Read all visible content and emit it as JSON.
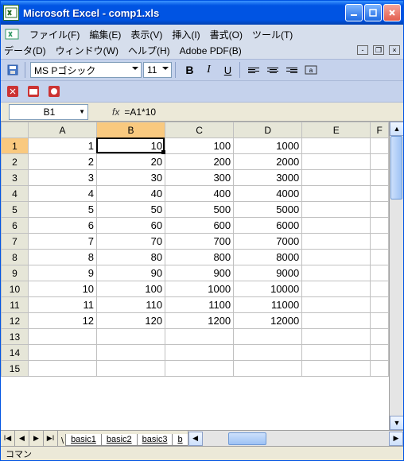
{
  "title": "Microsoft Excel - comp1.xls",
  "menus": {
    "file": "ファイル(F)",
    "edit": "編集(E)",
    "view": "表示(V)",
    "insert": "挿入(I)",
    "format": "書式(O)",
    "tools": "ツール(T)",
    "data": "データ(D)",
    "window": "ウィンドウ(W)",
    "help": "ヘルプ(H)",
    "adobe": "Adobe PDF(B)"
  },
  "font": {
    "name": "MS Pゴシック",
    "size": "11"
  },
  "namebox": "B1",
  "fx_label": "fx",
  "formula": "=A1*10",
  "columns": [
    "A",
    "B",
    "C",
    "D",
    "E",
    "F"
  ],
  "rows": [
    "1",
    "2",
    "3",
    "4",
    "5",
    "6",
    "7",
    "8",
    "9",
    "10",
    "11",
    "12",
    "13",
    "14",
    "15"
  ],
  "data": [
    [
      "1",
      "10",
      "100",
      "1000",
      "",
      ""
    ],
    [
      "2",
      "20",
      "200",
      "2000",
      "",
      ""
    ],
    [
      "3",
      "30",
      "300",
      "3000",
      "",
      ""
    ],
    [
      "4",
      "40",
      "400",
      "4000",
      "",
      ""
    ],
    [
      "5",
      "50",
      "500",
      "5000",
      "",
      ""
    ],
    [
      "6",
      "60",
      "600",
      "6000",
      "",
      ""
    ],
    [
      "7",
      "70",
      "700",
      "7000",
      "",
      ""
    ],
    [
      "8",
      "80",
      "800",
      "8000",
      "",
      ""
    ],
    [
      "9",
      "90",
      "900",
      "9000",
      "",
      ""
    ],
    [
      "10",
      "100",
      "1000",
      "10000",
      "",
      ""
    ],
    [
      "11",
      "110",
      "1100",
      "11000",
      "",
      ""
    ],
    [
      "12",
      "120",
      "1200",
      "12000",
      "",
      ""
    ],
    [
      "",
      "",
      "",
      "",
      "",
      ""
    ],
    [
      "",
      "",
      "",
      "",
      "",
      ""
    ],
    [
      "",
      "",
      "",
      "",
      "",
      ""
    ]
  ],
  "active": {
    "col": 1,
    "row": 0
  },
  "sheets": [
    "basic1",
    "basic2",
    "basic3",
    "b"
  ],
  "status": "コマン"
}
